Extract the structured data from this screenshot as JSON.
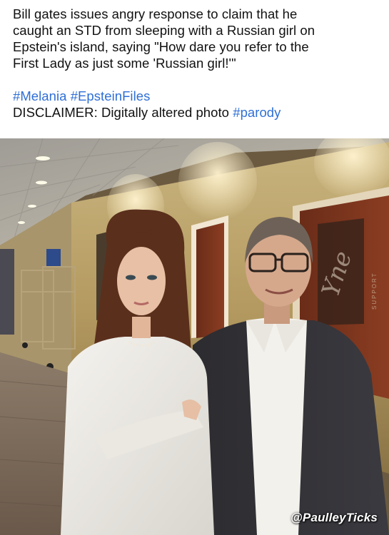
{
  "post": {
    "line1": "Bill gates issues angry response to claim that he",
    "line2": "caught an STD from sleeping with a Russian girl on",
    "line3": "Epstein's island, saying \"How dare you refer to the",
    "line4": "First Lady as just some 'Russian girl!'\"",
    "hashtag_melania": "#Melania",
    "hashtag_epstein": "#EpsteinFiles",
    "disclaimer": "DISCLAIMER: Digitally altered photo",
    "hashtag_parody": "#parody"
  },
  "photo": {
    "watermark": "@PaulleyTicks",
    "poster_script": "Yne",
    "poster_support": "SUPPORT"
  },
  "colors": {
    "hashtag": "#2f6fd6",
    "text": "#111111",
    "background": "#ffffff"
  }
}
